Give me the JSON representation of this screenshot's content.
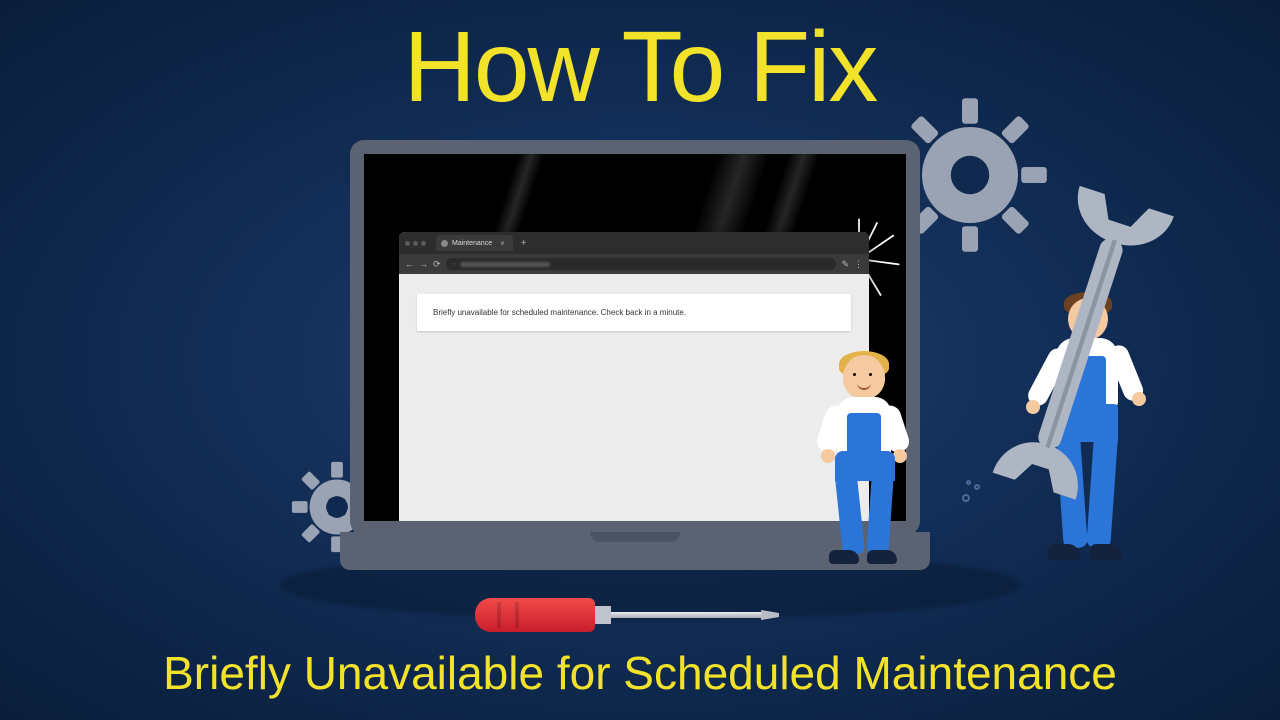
{
  "headline": "How To Fix",
  "subheadline": "Briefly Unavailable for Scheduled Maintenance",
  "browser": {
    "tab_label": "Maintenance",
    "message": "Briefly unavailable for scheduled maintenance. Check back in a minute."
  },
  "colors": {
    "accent_yellow": "#f2e22a",
    "bg_dark": "#0f294f",
    "worker_blue": "#2b74d8",
    "tool_red": "#c81e2c",
    "gear_gray": "#9aa3b3"
  }
}
